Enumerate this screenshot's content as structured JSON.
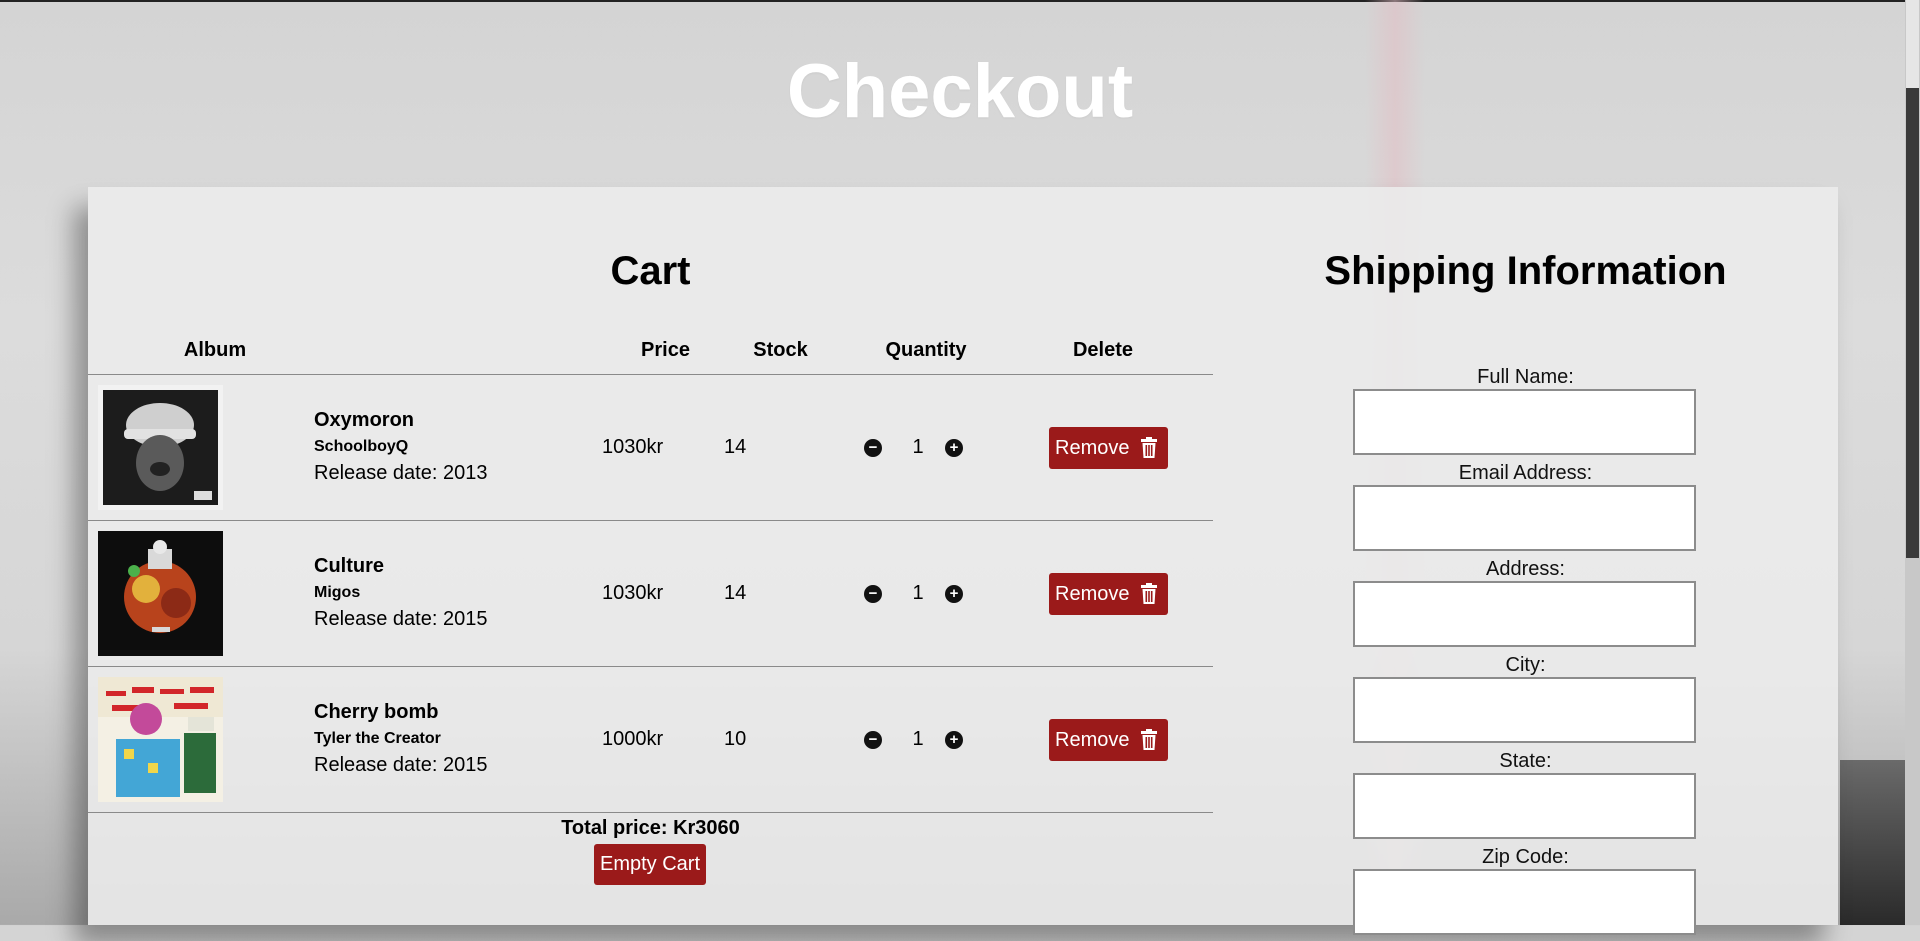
{
  "page": {
    "title": "Checkout"
  },
  "cart": {
    "title": "Cart",
    "headers": {
      "album": "Album",
      "price": "Price",
      "stock": "Stock",
      "quantity": "Quantity",
      "delete": "Delete"
    },
    "items": [
      {
        "name": "Oxymoron",
        "artist": "SchoolboyQ",
        "release": "Release date: 2013",
        "price": "1030kr",
        "stock": "14",
        "quantity": "1",
        "remove_label": "Remove"
      },
      {
        "name": "Culture",
        "artist": "Migos",
        "release": "Release date: 2015",
        "price": "1030kr",
        "stock": "14",
        "quantity": "1",
        "remove_label": "Remove"
      },
      {
        "name": "Cherry bomb",
        "artist": "Tyler the Creator",
        "release": "Release date: 2015",
        "price": "1000kr",
        "stock": "10",
        "quantity": "1",
        "remove_label": "Remove"
      }
    ],
    "total": "Total price: Kr3060",
    "empty_label": "Empty Cart"
  },
  "shipping": {
    "title": "Shipping Information",
    "fields": [
      {
        "label": "Full Name:",
        "value": ""
      },
      {
        "label": "Email Address:",
        "value": ""
      },
      {
        "label": "Address:",
        "value": ""
      },
      {
        "label": "City:",
        "value": ""
      },
      {
        "label": "State:",
        "value": ""
      },
      {
        "label": "Zip Code:",
        "value": ""
      }
    ]
  },
  "colors": {
    "button": "#9b1a1a",
    "panel": "#ececec",
    "title": "#ffffff"
  },
  "icons": {
    "minus": "minus-circle-icon",
    "plus": "plus-circle-icon",
    "remove": "trash-icon"
  }
}
